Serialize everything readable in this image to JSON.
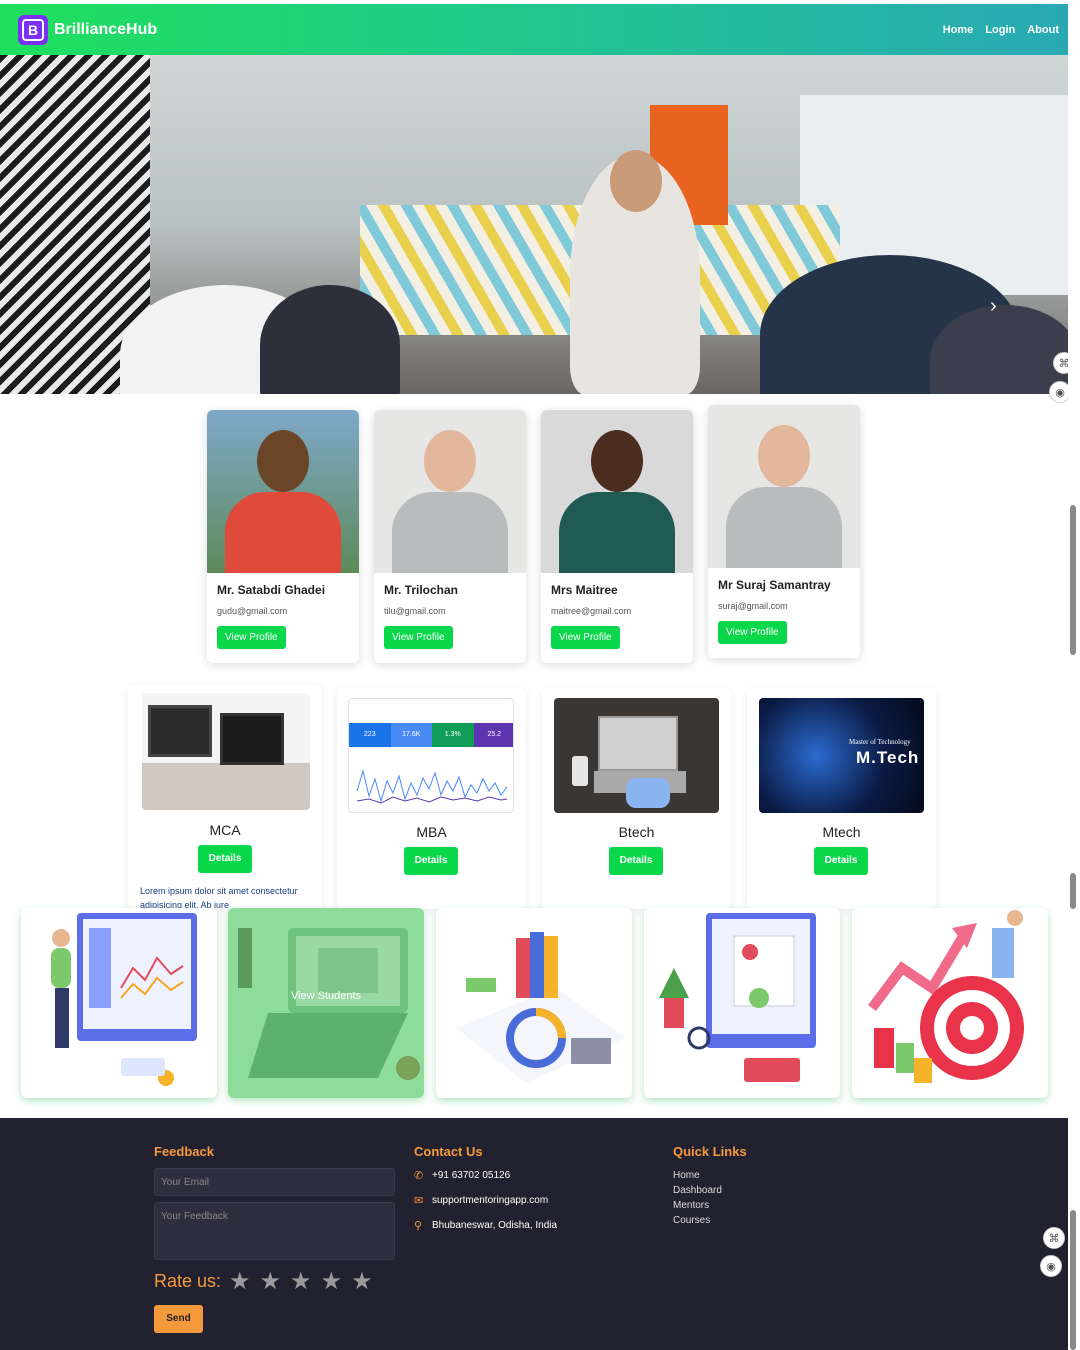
{
  "brand": {
    "logo_letter": "B",
    "name": "BrillianceHub"
  },
  "nav": {
    "items": [
      "Home",
      "Login",
      "About"
    ]
  },
  "mentors": [
    {
      "name": "Mr. Satabdi Ghadei",
      "email": "gudu@gmail.com",
      "button": "View Profile"
    },
    {
      "name": "Mr. Trilochan",
      "email": "tilu@gmail.com",
      "button": "View Profile"
    },
    {
      "name": "Mrs Maitree",
      "email": "maitree@gmail.com",
      "button": "View Profile"
    },
    {
      "name": "Mr Suraj Samantray",
      "email": "suraj@gmail.com",
      "button": "View Profile"
    }
  ],
  "courses": [
    {
      "title": "MCA",
      "button": "Details",
      "description": "Lorem ipsum dolor sit amet consectetur adipisicing elit. Ab iure"
    },
    {
      "title": "MBA",
      "button": "Details",
      "stats": [
        "223",
        "17.6K",
        "1.3%",
        "25.2"
      ]
    },
    {
      "title": "Btech",
      "button": "Details"
    },
    {
      "title": "Mtech",
      "button": "Details",
      "image_caption": "Master of Technology",
      "image_title": "M.Tech"
    }
  ],
  "illustrations": {
    "active_caption": "View Students"
  },
  "footer": {
    "feedback": {
      "heading": "Feedback",
      "email_placeholder": "Your Email",
      "feedback_placeholder": "Your Feedback",
      "rate_label": "Rate us:",
      "send_label": "Send",
      "stars": 5
    },
    "contact": {
      "heading": "Contact Us",
      "phone": "+91 63702 05126",
      "email": "supportmentoringapp.com",
      "address": "Bhubaneswar, Odisha, India"
    },
    "quick_links": {
      "heading": "Quick Links",
      "items": [
        "Home",
        "Dashboard",
        "Mentors",
        "Courses"
      ]
    }
  },
  "colors": {
    "accent_green": "#0ad84a",
    "footer_bg": "#22212f",
    "footer_accent": "#f59a3c",
    "brand_purple": "#7b2ff7"
  }
}
